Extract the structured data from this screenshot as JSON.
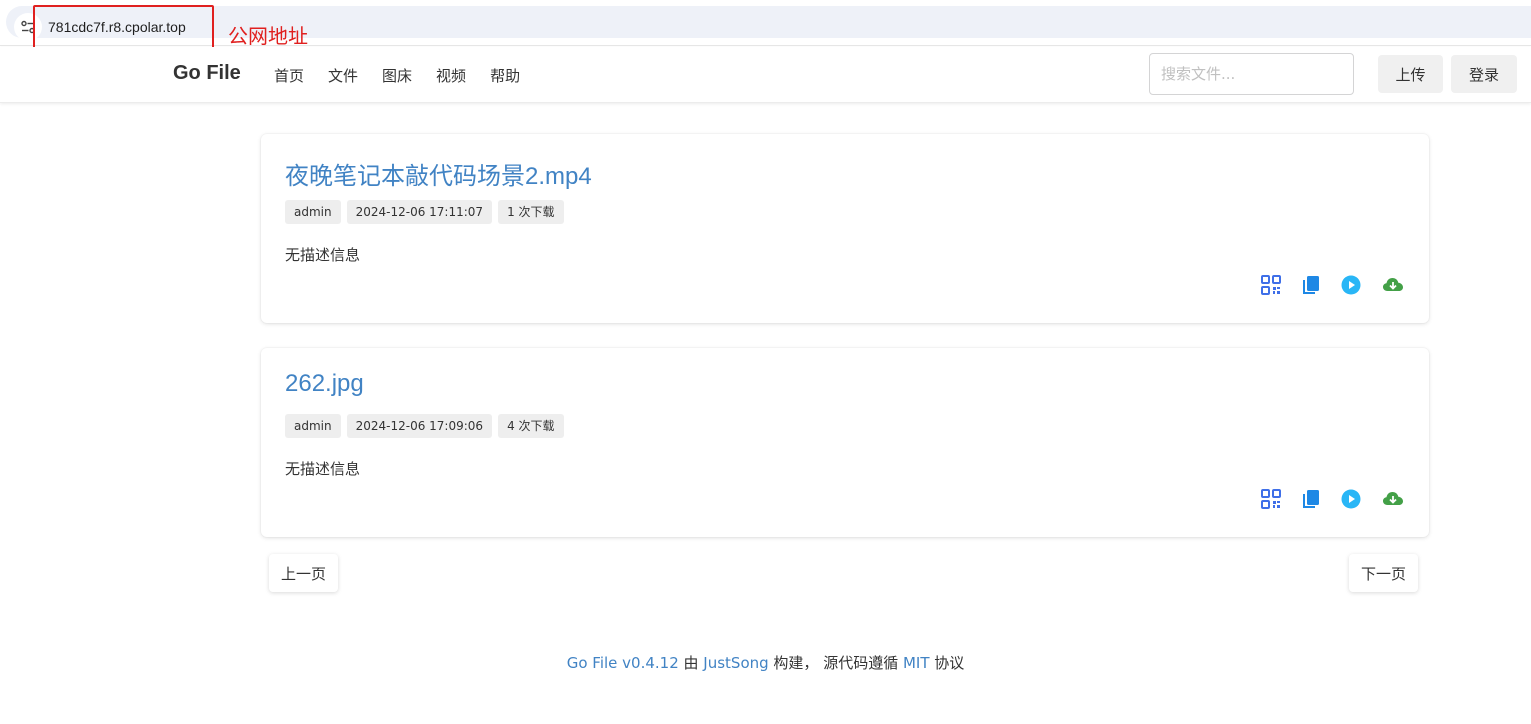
{
  "browser": {
    "url": "781cdc7f.r8.cpolar.top",
    "annotation_label": "公网地址",
    "annotation_color": "#e0201f"
  },
  "header": {
    "brand": "Go File",
    "nav": [
      "首页",
      "文件",
      "图床",
      "视频",
      "帮助"
    ],
    "search_placeholder": "搜索文件...",
    "upload_label": "上传",
    "login_label": "登录"
  },
  "files": [
    {
      "title": "夜晚笔记本敲代码场景2.mp4",
      "uploader": "admin",
      "time": "2024-12-06 17:11:07",
      "downloads": "1 次下载",
      "description": "无描述信息"
    },
    {
      "title": "262.jpg",
      "uploader": "admin",
      "time": "2024-12-06 17:09:06",
      "downloads": "4 次下载",
      "description": "无描述信息"
    }
  ],
  "action_icons": [
    "qrcode-icon",
    "copy-icon",
    "play-icon",
    "cloud-download-icon"
  ],
  "pagination": {
    "prev": "上一页",
    "next": "下一页"
  },
  "footer": {
    "app": "Go File v0.4.12",
    "by": " 由 ",
    "author": "JustSong",
    "built": " 构建， 源代码遵循 ",
    "license": "MIT",
    "tail": " 协议"
  },
  "colors": {
    "link": "#4183c4",
    "qr_icon": "#3f6fe8",
    "copy_icon": "#1e88e5",
    "play_icon": "#29b6f6",
    "download_icon": "#43a047"
  }
}
